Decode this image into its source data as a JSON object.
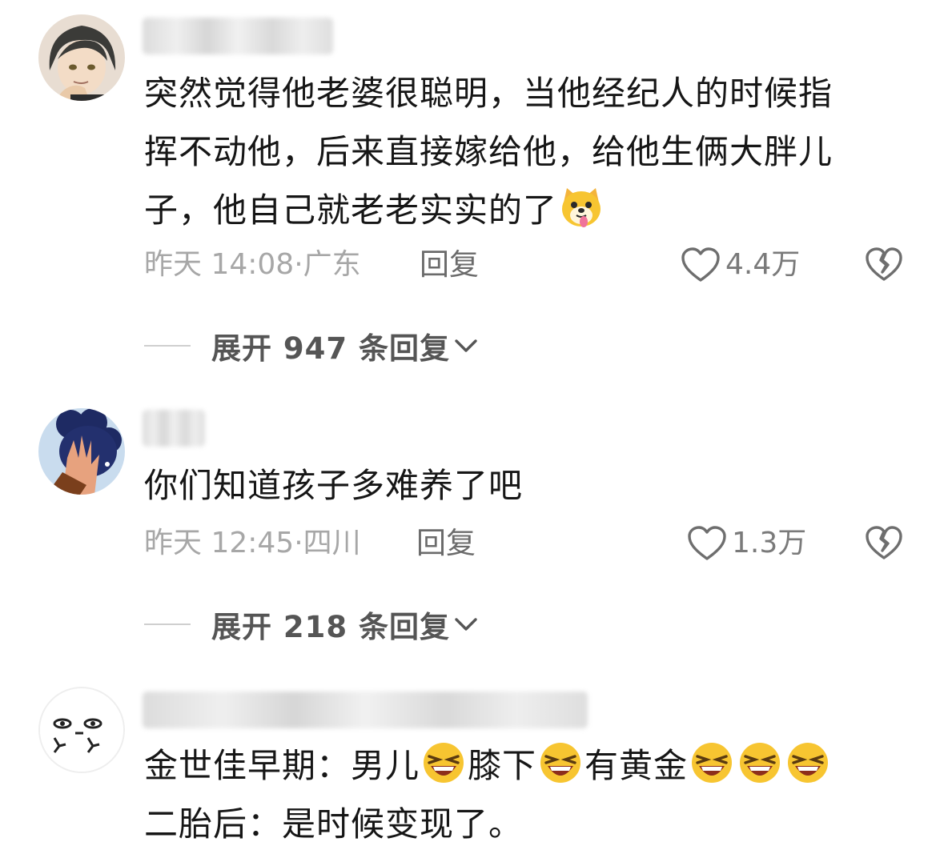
{
  "comments": [
    {
      "text_lines": [
        "突然觉得他老婆很聪明，当他经纪人的时候指",
        "挥不动他，后来直接嫁给他，给他生俩大胖儿",
        "子，他自己就老老实实的了"
      ],
      "trailing_emoji": "dog-tongue-emoji",
      "time": "昨天 14:08",
      "location": "广东",
      "reply_label": "回复",
      "likes": "4.4万",
      "expand_label": "展开 947 条回复"
    },
    {
      "text_lines": [
        "你们知道孩子多难养了吧"
      ],
      "time": "昨天 12:45",
      "location": "四川",
      "reply_label": "回复",
      "likes": "1.3万",
      "expand_label": "展开 218 条回复"
    },
    {
      "line1_parts": [
        "金世佳早期：男儿",
        "膝下",
        "有黄金"
      ],
      "line1_emoji": "laughing-squint-emoji",
      "line2": "二胎后：是时候变现了。"
    }
  ],
  "colors": {
    "text": "#161616",
    "meta": "#a7a7a7",
    "icon": "#6e6e6e",
    "emoji_yellow": "#f7c531"
  }
}
